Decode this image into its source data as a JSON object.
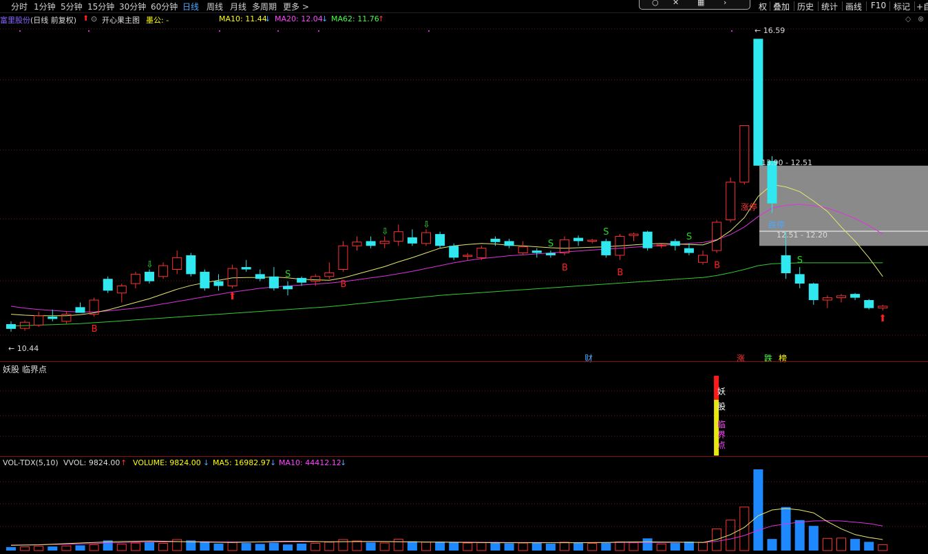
{
  "toolbar": {
    "periods": [
      "分时",
      "1分钟",
      "5分钟",
      "15分钟",
      "30分钟",
      "60分钟",
      "日线",
      "周线",
      "月线",
      "多周期",
      "更多 >"
    ],
    "active_period": "日线",
    "right_buttons": [
      "权",
      "叠加",
      "历史",
      "统计",
      "画线",
      "F10",
      "标记",
      "+自"
    ],
    "float_box_icons": [
      "circle-icon",
      "cross-icon",
      "grid-icon",
      "chevron-icon"
    ]
  },
  "main_panel": {
    "stock_name": "富里股份",
    "mode": "(日线 前复权)",
    "formula": "开心果主图",
    "formula_extra": "墨公: -",
    "ma10": {
      "label": "MA10: 11.44",
      "arrow": "↓",
      "color": "#ffff00"
    },
    "ma20": {
      "label": "MA20: 12.04",
      "arrow": "↓",
      "color": "#ff44ff"
    },
    "ma62": {
      "label": "MA62: 11.76",
      "arrow": "↑",
      "color": "#44ff44"
    },
    "high_label": "16.59",
    "low_label": "10.44",
    "zone1_label": "13.90 - 12.51",
    "zone2_label": "12.51 - 12.20",
    "zhangting_label": "涨停",
    "dieting_label": "跌停",
    "bottom_marks": {
      "cai": "财",
      "zhang": "涨",
      "die": "跌",
      "bang": "榜"
    }
  },
  "indicator_panel": {
    "title": "妖股 临界点",
    "bar_labels": [
      "妖",
      "股",
      "临",
      "界",
      "点"
    ]
  },
  "volume_panel": {
    "name": "VOL-TDX(5,10)",
    "vvol": "VVOL: 9824.00",
    "volume": "VOLUME: 9824.00",
    "ma5": "MA5: 16982.97",
    "ma10": "MA10: 44412.12",
    "up_arrow": "↑",
    "down_arrow": "↓"
  },
  "chart_data": {
    "type": "candlestick",
    "price_axis": {
      "min": 10.0,
      "max": 16.8
    },
    "candles": [
      {
        "o": 10.54,
        "h": 10.6,
        "l": 10.38,
        "c": 10.44,
        "v": 1200
      },
      {
        "o": 10.45,
        "h": 10.62,
        "l": 10.4,
        "c": 10.58,
        "v": 1300
      },
      {
        "o": 10.52,
        "h": 10.8,
        "l": 10.48,
        "c": 10.72,
        "v": 1500
      },
      {
        "o": 10.7,
        "h": 10.85,
        "l": 10.6,
        "c": 10.65,
        "v": 1400
      },
      {
        "o": 10.6,
        "h": 10.82,
        "l": 10.55,
        "c": 10.75,
        "v": 1600
      },
      {
        "o": 10.9,
        "h": 11.0,
        "l": 10.8,
        "c": 10.78,
        "v": 1800
      },
      {
        "o": 10.75,
        "h": 11.1,
        "l": 10.7,
        "c": 11.05,
        "v": 2000
      },
      {
        "o": 11.5,
        "h": 11.55,
        "l": 11.2,
        "c": 11.25,
        "v": 3500
      },
      {
        "o": 11.2,
        "h": 11.4,
        "l": 11.0,
        "c": 11.35,
        "v": 2200
      },
      {
        "o": 11.4,
        "h": 11.65,
        "l": 11.3,
        "c": 11.6,
        "v": 2600
      },
      {
        "o": 11.65,
        "h": 11.7,
        "l": 11.4,
        "c": 11.45,
        "v": 3000
      },
      {
        "o": 11.55,
        "h": 11.85,
        "l": 11.5,
        "c": 11.78,
        "v": 2500
      },
      {
        "o": 11.7,
        "h": 12.1,
        "l": 11.6,
        "c": 11.95,
        "v": 3800
      },
      {
        "o": 12.0,
        "h": 12.05,
        "l": 11.55,
        "c": 11.6,
        "v": 3500
      },
      {
        "o": 11.65,
        "h": 11.7,
        "l": 11.25,
        "c": 11.3,
        "v": 3200
      },
      {
        "o": 11.45,
        "h": 11.6,
        "l": 11.25,
        "c": 11.35,
        "v": 2400
      },
      {
        "o": 11.35,
        "h": 11.8,
        "l": 11.3,
        "c": 11.72,
        "v": 2800
      },
      {
        "o": 11.75,
        "h": 11.9,
        "l": 11.65,
        "c": 11.7,
        "v": 2600
      },
      {
        "o": 11.6,
        "h": 11.7,
        "l": 11.45,
        "c": 11.5,
        "v": 2300
      },
      {
        "o": 11.55,
        "h": 11.75,
        "l": 11.25,
        "c": 11.3,
        "v": 2700
      },
      {
        "o": 11.35,
        "h": 11.45,
        "l": 11.15,
        "c": 11.28,
        "v": 2100
      },
      {
        "o": 11.52,
        "h": 11.55,
        "l": 11.35,
        "c": 11.42,
        "v": 2400
      },
      {
        "o": 11.45,
        "h": 11.6,
        "l": 11.35,
        "c": 11.55,
        "v": 2500
      },
      {
        "o": 11.55,
        "h": 11.85,
        "l": 11.5,
        "c": 11.63,
        "v": 2900
      },
      {
        "o": 11.7,
        "h": 12.3,
        "l": 11.65,
        "c": 12.2,
        "v": 3800
      },
      {
        "o": 12.2,
        "h": 12.4,
        "l": 12.1,
        "c": 12.28,
        "v": 3300
      },
      {
        "o": 12.3,
        "h": 12.4,
        "l": 12.15,
        "c": 12.2,
        "v": 2800
      },
      {
        "o": 12.25,
        "h": 12.4,
        "l": 12.15,
        "c": 12.3,
        "v": 2600
      },
      {
        "o": 12.3,
        "h": 12.65,
        "l": 12.2,
        "c": 12.5,
        "v": 3900
      },
      {
        "o": 12.38,
        "h": 12.55,
        "l": 12.2,
        "c": 12.25,
        "v": 3200
      },
      {
        "o": 12.25,
        "h": 12.55,
        "l": 12.2,
        "c": 12.48,
        "v": 2900
      },
      {
        "o": 12.45,
        "h": 12.5,
        "l": 12.15,
        "c": 12.2,
        "v": 3100
      },
      {
        "o": 12.2,
        "h": 12.25,
        "l": 11.9,
        "c": 11.95,
        "v": 3000
      },
      {
        "o": 11.98,
        "h": 12.05,
        "l": 11.9,
        "c": 12.0,
        "v": 2600
      },
      {
        "o": 11.95,
        "h": 12.2,
        "l": 11.9,
        "c": 12.15,
        "v": 2700
      },
      {
        "o": 12.35,
        "h": 12.4,
        "l": 12.2,
        "c": 12.28,
        "v": 2800
      },
      {
        "o": 12.3,
        "h": 12.35,
        "l": 12.15,
        "c": 12.2,
        "v": 2500
      },
      {
        "o": 12.05,
        "h": 12.3,
        "l": 12.0,
        "c": 12.18,
        "v": 2600
      },
      {
        "o": 12.1,
        "h": 12.15,
        "l": 11.95,
        "c": 12.05,
        "v": 2700
      },
      {
        "o": 12.05,
        "h": 12.1,
        "l": 11.95,
        "c": 12.0,
        "v": 2400
      },
      {
        "o": 12.05,
        "h": 12.4,
        "l": 12.0,
        "c": 12.33,
        "v": 2900
      },
      {
        "o": 12.37,
        "h": 12.42,
        "l": 12.2,
        "c": 12.3,
        "v": 2800
      },
      {
        "o": 12.3,
        "h": 12.35,
        "l": 12.25,
        "c": 12.32,
        "v": 2500
      },
      {
        "o": 12.3,
        "h": 12.35,
        "l": 11.95,
        "c": 12.0,
        "v": 2600
      },
      {
        "o": 12.0,
        "h": 12.45,
        "l": 11.9,
        "c": 12.4,
        "v": 3000
      },
      {
        "o": 12.42,
        "h": 12.48,
        "l": 12.3,
        "c": 12.45,
        "v": 2700
      },
      {
        "o": 12.5,
        "h": 12.52,
        "l": 12.1,
        "c": 12.15,
        "v": 4200
      },
      {
        "o": 12.2,
        "h": 12.25,
        "l": 12.15,
        "c": 12.22,
        "v": 2300
      },
      {
        "o": 12.3,
        "h": 12.35,
        "l": 12.1,
        "c": 12.2,
        "v": 2600
      },
      {
        "o": 12.15,
        "h": 12.25,
        "l": 12.0,
        "c": 12.05,
        "v": 3100
      },
      {
        "o": 11.85,
        "h": 12.1,
        "l": 11.8,
        "c": 12.0,
        "v": 2800
      },
      {
        "o": 12.1,
        "h": 12.75,
        "l": 12.05,
        "c": 12.7,
        "v": 7500
      },
      {
        "o": 12.75,
        "h": 13.65,
        "l": 12.7,
        "c": 13.55,
        "v": 10500
      },
      {
        "o": 13.55,
        "h": 14.75,
        "l": 13.5,
        "c": 14.75,
        "v": 15000
      },
      {
        "o": 16.59,
        "h": 16.59,
        "l": 13.9,
        "c": 13.9,
        "v": 28000
      },
      {
        "o": 14.0,
        "h": 14.1,
        "l": 12.9,
        "c": 13.1,
        "v": 4000
      },
      {
        "o": 12.0,
        "h": 12.5,
        "l": 11.5,
        "c": 11.62,
        "v": 15000
      },
      {
        "o": 11.6,
        "h": 11.75,
        "l": 11.3,
        "c": 11.4,
        "v": 10500
      },
      {
        "o": 11.4,
        "h": 11.42,
        "l": 10.95,
        "c": 11.05,
        "v": 8500
      },
      {
        "o": 11.05,
        "h": 11.15,
        "l": 10.88,
        "c": 11.1,
        "v": 4200
      },
      {
        "o": 11.1,
        "h": 11.18,
        "l": 11.0,
        "c": 11.14,
        "v": 4300
      },
      {
        "o": 11.18,
        "h": 11.2,
        "l": 11.05,
        "c": 11.1,
        "v": 4000
      },
      {
        "o": 11.05,
        "h": 11.07,
        "l": 10.85,
        "c": 10.88,
        "v": 3000
      },
      {
        "o": 10.88,
        "h": 10.95,
        "l": 10.83,
        "c": 10.92,
        "v": 2000
      }
    ],
    "ma10": [
      10.75,
      10.73,
      10.72,
      10.72,
      10.72,
      10.74,
      10.78,
      10.84,
      10.92,
      11.0,
      11.08,
      11.18,
      11.28,
      11.36,
      11.42,
      11.47,
      11.52,
      11.53,
      11.53,
      11.54,
      11.52,
      11.49,
      11.48,
      11.47,
      11.52,
      11.6,
      11.68,
      11.76,
      11.86,
      11.95,
      12.05,
      12.15,
      12.2,
      12.23,
      12.25,
      12.24,
      12.21,
      12.2,
      12.18,
      12.16,
      12.15,
      12.16,
      12.17,
      12.18,
      12.2,
      12.22,
      12.24,
      12.25,
      12.24,
      12.23,
      12.22,
      12.32,
      12.52,
      12.8,
      13.25,
      13.5,
      13.45,
      13.35,
      13.15,
      12.93,
      12.6,
      12.3,
      11.95,
      11.55
    ],
    "ma20": [
      10.92,
      10.88,
      10.85,
      10.83,
      10.81,
      10.8,
      10.8,
      10.82,
      10.85,
      10.88,
      10.92,
      10.97,
      11.02,
      11.07,
      11.12,
      11.17,
      11.22,
      11.26,
      11.3,
      11.33,
      11.35,
      11.37,
      11.39,
      11.41,
      11.44,
      11.48,
      11.52,
      11.56,
      11.61,
      11.66,
      11.72,
      11.78,
      11.84,
      11.89,
      11.93,
      11.96,
      11.99,
      12.01,
      12.03,
      12.05,
      12.07,
      12.09,
      12.11,
      12.13,
      12.15,
      12.17,
      12.19,
      12.21,
      12.23,
      12.25,
      12.27,
      12.33,
      12.44,
      12.6,
      12.82,
      13.0,
      13.06,
      13.08,
      13.05,
      13.0,
      12.9,
      12.78,
      12.63,
      12.45
    ],
    "ma62": [
      10.5,
      10.51,
      10.52,
      10.53,
      10.54,
      10.55,
      10.57,
      10.59,
      10.61,
      10.63,
      10.65,
      10.67,
      10.69,
      10.71,
      10.73,
      10.75,
      10.77,
      10.79,
      10.81,
      10.83,
      10.85,
      10.87,
      10.89,
      10.91,
      10.94,
      10.97,
      11.0,
      11.03,
      11.06,
      11.09,
      11.12,
      11.15,
      11.17,
      11.19,
      11.21,
      11.23,
      11.25,
      11.27,
      11.29,
      11.31,
      11.33,
      11.35,
      11.37,
      11.39,
      11.41,
      11.43,
      11.45,
      11.47,
      11.49,
      11.51,
      11.53,
      11.57,
      11.63,
      11.7,
      11.78,
      11.82,
      11.83,
      11.84,
      11.84,
      11.84,
      11.84,
      11.84,
      11.84,
      11.84
    ],
    "vol_ma5": [
      1800,
      1900,
      2000,
      2200,
      2400,
      2600,
      2800,
      3000,
      3100,
      3200,
      3300,
      3200,
      3100,
      3000,
      2900,
      2850,
      2800,
      2900,
      3000,
      3100,
      3200,
      3200,
      3100,
      3000,
      3050,
      3100,
      3150,
      3100,
      3050,
      3000,
      2950,
      2900,
      2850,
      2800,
      2750,
      2700,
      2700,
      2700,
      2700,
      2700,
      2700,
      2700,
      2750,
      2800,
      2900,
      3000,
      3000,
      2950,
      2900,
      2850,
      2800,
      3800,
      5500,
      8000,
      12000,
      14000,
      14500,
      14000,
      13000,
      10000,
      7500,
      5500,
      4500,
      3800
    ],
    "vol_ma10": [
      1900,
      1950,
      2000,
      2100,
      2200,
      2300,
      2450,
      2600,
      2750,
      2850,
      2950,
      3000,
      3050,
      3050,
      3050,
      3000,
      3000,
      2950,
      2950,
      2950,
      3000,
      3000,
      3050,
      3050,
      3050,
      3050,
      3050,
      3050,
      3000,
      3000,
      2950,
      2950,
      2900,
      2900,
      2850,
      2850,
      2800,
      2800,
      2780,
      2760,
      2750,
      2750,
      2750,
      2760,
      2780,
      2800,
      2800,
      2800,
      2820,
      2840,
      2850,
      3200,
      4000,
      5200,
      7000,
      8500,
      9200,
      9800,
      10200,
      10300,
      10200,
      9800,
      9300,
      8500
    ],
    "signals": {
      "B": [
        6,
        24,
        40,
        44,
        51
      ],
      "S": [
        20,
        39,
        43,
        49,
        57
      ],
      "green_arrows": [
        10,
        27,
        30
      ],
      "red_arrows": [
        16,
        63
      ]
    },
    "zone1": {
      "top": 13.9,
      "bottom": 12.51
    },
    "zone2": {
      "top": 12.51,
      "bottom": 12.2
    },
    "yao_gu_bar": {
      "index": 51,
      "red_frac": 0.3
    }
  }
}
